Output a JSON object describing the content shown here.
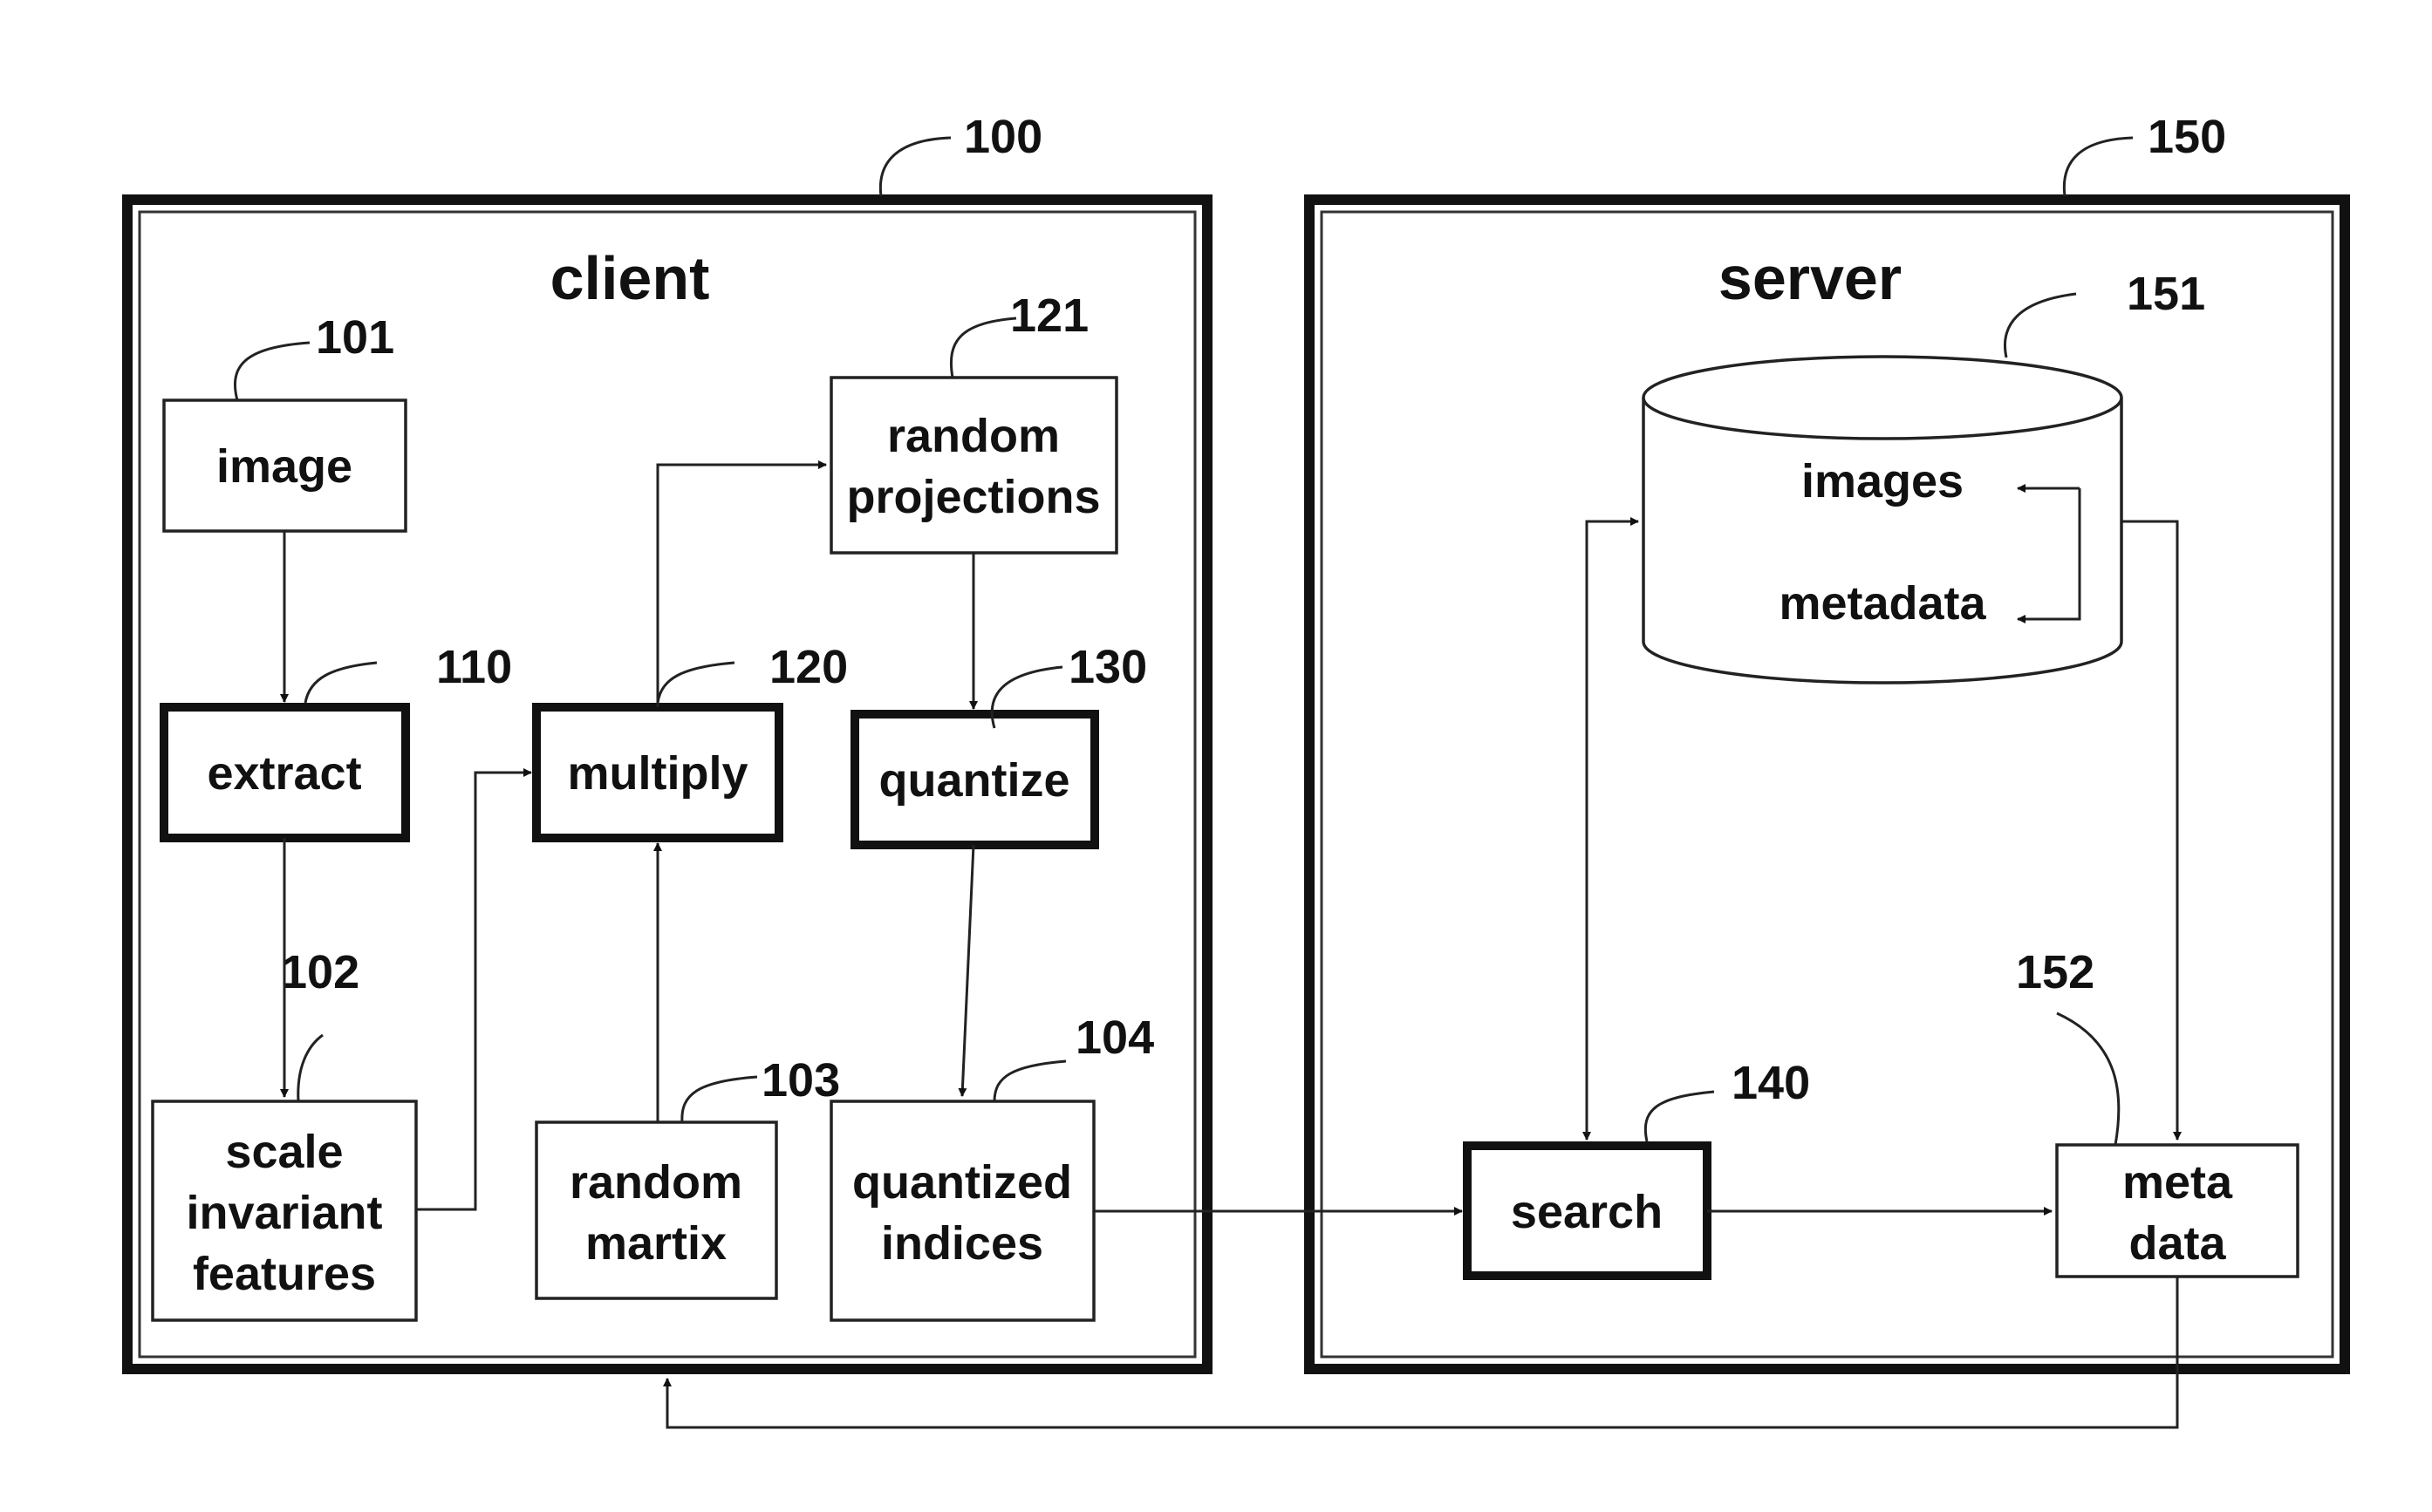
{
  "diagram": {
    "client": {
      "title": "client",
      "ref": "100",
      "blocks": {
        "image": {
          "label_lines": [
            "image"
          ],
          "ref": "101"
        },
        "extract": {
          "label_lines": [
            "extract"
          ],
          "ref": "110"
        },
        "scale_invariant_features": {
          "label_lines": [
            "scale",
            "invariant",
            "features"
          ],
          "ref": "102"
        },
        "multiply": {
          "label_lines": [
            "multiply"
          ],
          "ref": "120"
        },
        "random_projections": {
          "label_lines": [
            "random",
            "projections"
          ],
          "ref": "121"
        },
        "quantize": {
          "label_lines": [
            "quantize"
          ],
          "ref": "130"
        },
        "random_matrix": {
          "label_lines": [
            "random",
            "martix"
          ],
          "ref": "103"
        },
        "quantized_indices": {
          "label_lines": [
            "quantized",
            "indices"
          ],
          "ref": "104"
        }
      }
    },
    "server": {
      "title": "server",
      "ref": "150",
      "database": {
        "ref": "151",
        "items": [
          "images",
          "metadata"
        ]
      },
      "blocks": {
        "search": {
          "label_lines": [
            "search"
          ],
          "ref": "140"
        },
        "meta_data": {
          "label_lines": [
            "meta",
            "data"
          ],
          "ref": "152"
        }
      }
    },
    "edges": [
      {
        "from": "image",
        "to": "extract"
      },
      {
        "from": "extract",
        "to": "scale_invariant_features"
      },
      {
        "from": "scale_invariant_features",
        "to": "multiply"
      },
      {
        "from": "random_matrix",
        "to": "multiply"
      },
      {
        "from": "multiply",
        "to": "random_projections"
      },
      {
        "from": "random_projections",
        "to": "quantize"
      },
      {
        "from": "quantize",
        "to": "quantized_indices"
      },
      {
        "from": "quantized_indices",
        "to": "search"
      },
      {
        "from": "search",
        "to": "database",
        "bidirectional": true
      },
      {
        "from": "search",
        "to": "meta_data"
      },
      {
        "from": "database",
        "to": "meta_data"
      },
      {
        "from": "images",
        "to": "metadata"
      },
      {
        "from": "meta_data",
        "to": "client"
      }
    ]
  }
}
